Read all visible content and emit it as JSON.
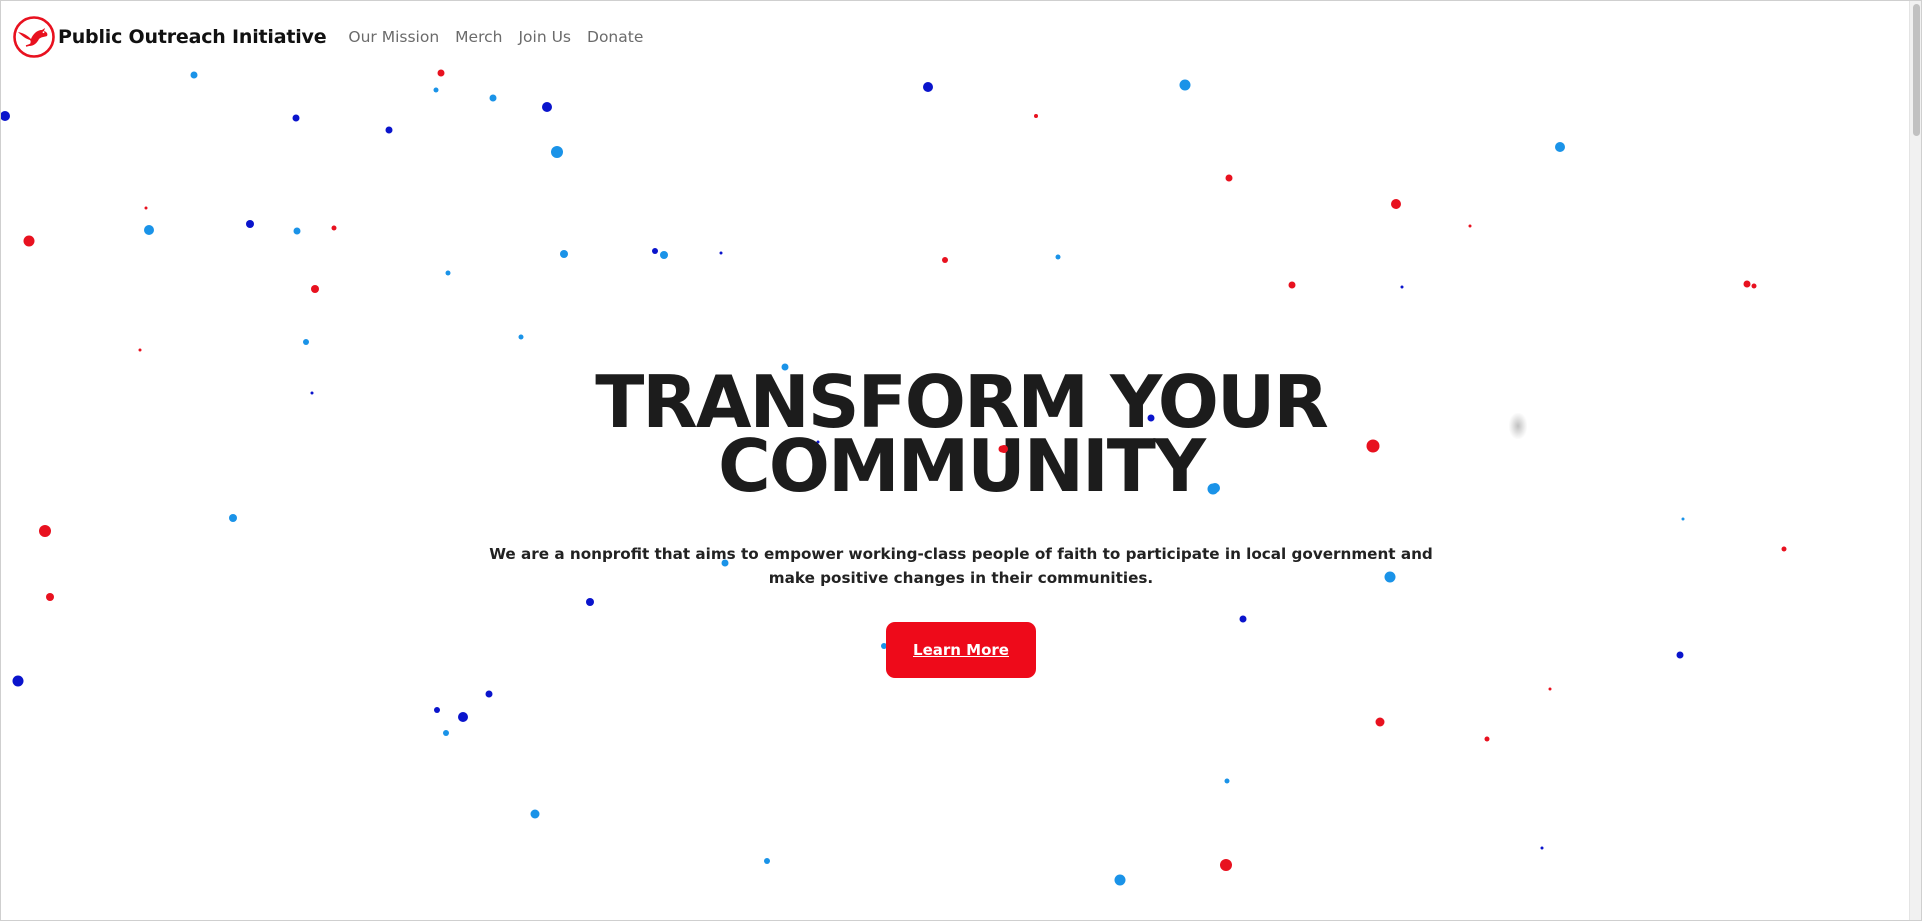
{
  "navbar": {
    "brand_name": "Public Outreach Initiative",
    "logo_icon": "dove-logo-icon",
    "links": [
      "Our Mission",
      "Merch",
      "Join Us",
      "Donate"
    ]
  },
  "hero": {
    "title_line1": "TRANSFORM YOUR",
    "title_line2": "COMMUNITY",
    "subtitle": "We are a nonprofit that aims to empower working-class people of faith to participate in local government and make positive changes in their communities.",
    "cta_label": "Learn More"
  },
  "colors": {
    "accent_red": "#ee0a1a",
    "particle_red": "#e8111f",
    "particle_blue": "#1a93e8",
    "particle_navy": "#0a14cc",
    "text_dark": "#1c1c1c",
    "nav_gray": "#6b6b6b"
  }
}
